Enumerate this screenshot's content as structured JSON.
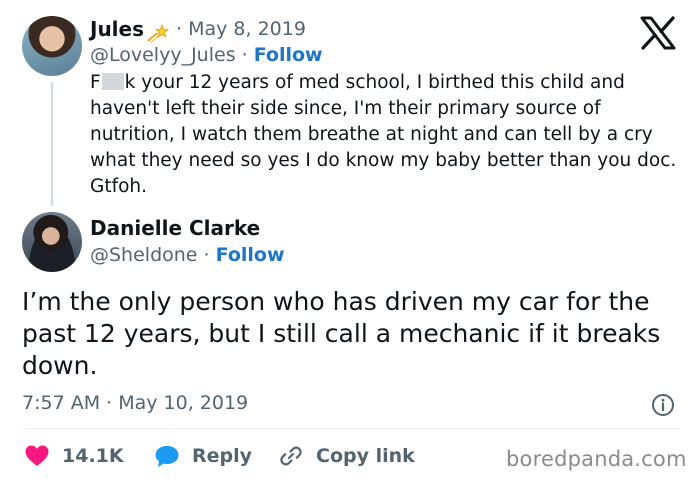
{
  "quoted_tweet": {
    "author_name": "Jules",
    "date": "May 8, 2019",
    "handle": "@Lovelyy_Jules",
    "follow_label": "Follow",
    "text_prefix": "F",
    "text_after_censor": "k your 12 years of med school, I birthed this child and haven't left their side since, I'm their primary source of nutrition, I watch them breathe at night and can tell by a cry what they need so yes I do know my baby better than you doc. Gtfoh."
  },
  "main_tweet": {
    "author_name": "Danielle Clarke",
    "handle": "@Sheldone",
    "follow_label": "Follow",
    "text": "I’m the only person who has driven my car for the past 12 years, but I still call a mechanic if it breaks down.",
    "timestamp": "7:57 AM · May 10, 2019"
  },
  "actions": {
    "like_count": "14.1K",
    "reply_label": "Reply",
    "copy_label": "Copy link"
  },
  "watermark": "boredpanda.com",
  "colors": {
    "text": "#0f1419",
    "muted": "#536471",
    "link": "#1d76c8",
    "like": "#f91880",
    "reply": "#1d9bf0"
  },
  "icons": {
    "x_logo": "x-logo-icon",
    "verified": "shooting-star-emoji-icon",
    "like": "heart-icon",
    "reply": "speech-bubble-icon",
    "copy": "link-icon",
    "info": "info-icon"
  }
}
